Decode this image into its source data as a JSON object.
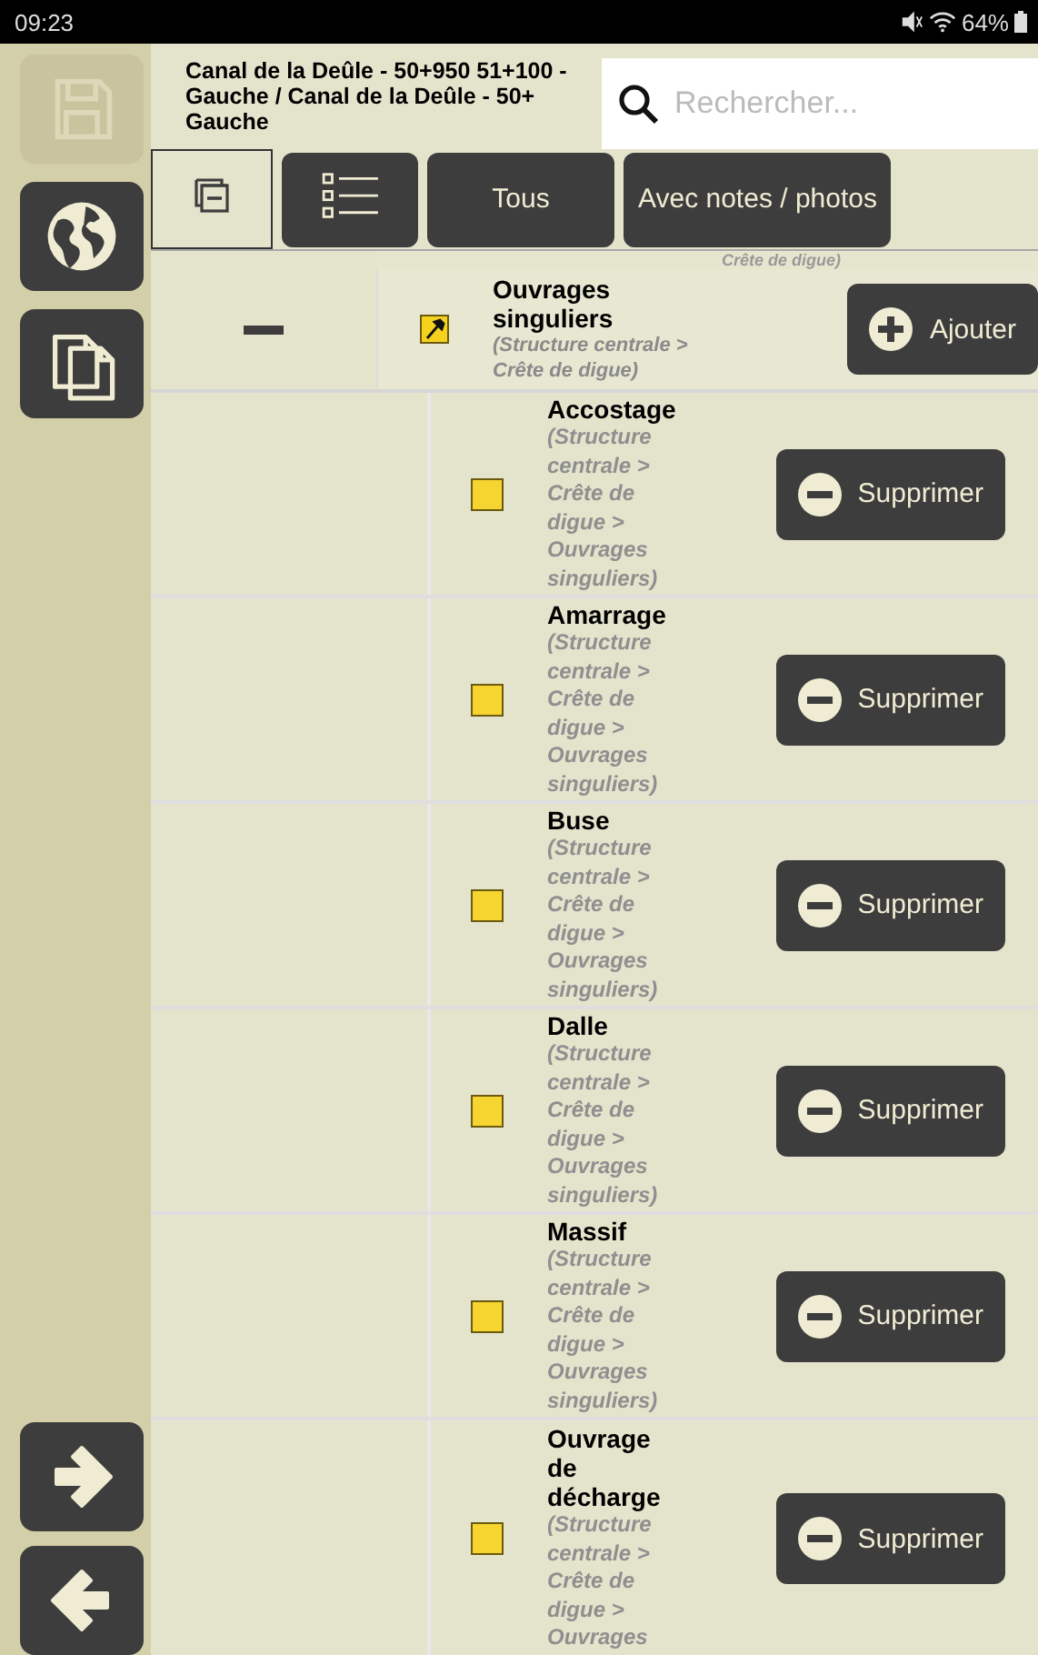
{
  "status_bar": {
    "time": "09:23",
    "battery": "64%"
  },
  "sidebar": {
    "top": [
      {
        "kind": "save",
        "disabled": true
      },
      {
        "kind": "globe",
        "disabled": false
      },
      {
        "kind": "copy",
        "disabled": false
      }
    ],
    "bottom": [
      {
        "kind": "next"
      },
      {
        "kind": "previous"
      }
    ]
  },
  "header": {
    "title_lines": [
      "Canal de la Deûle - 50+950 51+100 - Gauche / Canal de la Deûle - 50+",
      "Gauche"
    ],
    "search": {
      "placeholder": "Rechercher..."
    }
  },
  "tabs": [
    {
      "kind": "collapse",
      "selected": true
    },
    {
      "kind": "list",
      "selected": false
    },
    {
      "kind": "text",
      "label": "Tous",
      "selected": false
    },
    {
      "kind": "text",
      "label": "Avec notes / photos",
      "selected": false
    }
  ],
  "previous_row_tail": "Crête de digue)",
  "parent": {
    "expanded": true,
    "name": "Ouvrages singuliers",
    "path": "(Structure centrale > Crête de digue)",
    "button": "Ajouter"
  },
  "children": [
    {
      "name": "Accostage",
      "path": "(Structure centrale > Crête de digue > Ouvrages singuliers)",
      "button": "Supprimer"
    },
    {
      "name": "Amarrage",
      "path": "(Structure centrale > Crête de digue > Ouvrages singuliers)",
      "button": "Supprimer"
    },
    {
      "name": "Buse",
      "path": "(Structure centrale > Crête de digue > Ouvrages singuliers)",
      "button": "Supprimer"
    },
    {
      "name": "Dalle",
      "path": "(Structure centrale > Crête de digue > Ouvrages singuliers)",
      "button": "Supprimer"
    },
    {
      "name": "Massif",
      "path": "(Structure centrale > Crête de digue > Ouvrages singuliers)",
      "button": "Supprimer"
    },
    {
      "name": "Ouvrage de décharge",
      "path": "(Structure centrale > Crête de digue > Ouvrages",
      "button": "Supprimer"
    }
  ]
}
